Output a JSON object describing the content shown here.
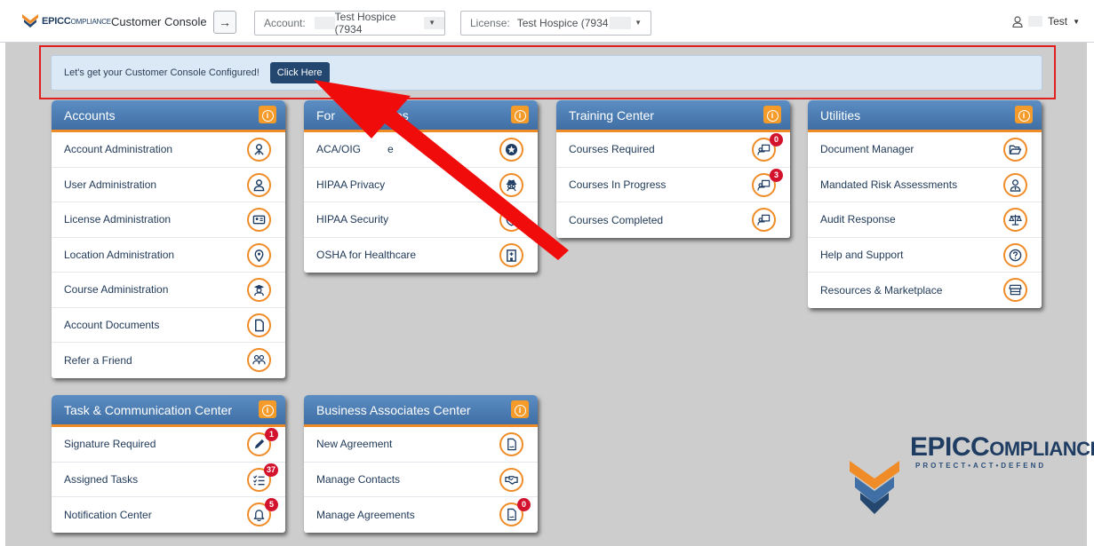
{
  "header": {
    "brand_main": "EPIC",
    "brand_rest": "OMPLIANCE",
    "brand_c": "C",
    "title": "Customer Console",
    "go_icon": "arrow-right-icon",
    "account_label": "Account:",
    "account_value": "Test Hospice (7934",
    "license_label": "License:",
    "license_value": "Test Hospice (7934",
    "user_name": "Test"
  },
  "banner": {
    "message": "Let's get your Customer Console Configured!",
    "cta": "Click Here"
  },
  "accounts": {
    "title": "Accounts",
    "items": [
      {
        "label": "Account Administration",
        "icon": "user-network-icon"
      },
      {
        "label": "User Administration",
        "icon": "user-icon"
      },
      {
        "label": "License Administration",
        "icon": "id-card-icon"
      },
      {
        "label": "Location Administration",
        "icon": "map-pin-icon"
      },
      {
        "label": "Course Administration",
        "icon": "graduate-icon"
      },
      {
        "label": "Account Documents",
        "icon": "document-icon"
      },
      {
        "label": "Refer a Friend",
        "icon": "users-icon"
      }
    ]
  },
  "forms": {
    "title_left": "For",
    "title_right": "es",
    "items": [
      {
        "label_left": "ACA/OIG",
        "label_right": "e",
        "icon": "star-icon"
      },
      {
        "label": "HIPAA Privacy",
        "icon": "spy-icon"
      },
      {
        "label": "HIPAA Security",
        "icon": "shield-icon"
      },
      {
        "label": "OSHA for Healthcare",
        "icon": "hospital-icon"
      }
    ]
  },
  "training": {
    "title": "Training Center",
    "items": [
      {
        "label": "Courses Required",
        "icon": "teacher-board-icon",
        "badge": "0"
      },
      {
        "label": "Courses In Progress",
        "icon": "teacher-board-icon",
        "badge": "3"
      },
      {
        "label": "Courses Completed",
        "icon": "teacher-board-icon"
      }
    ]
  },
  "utilities": {
    "title": "Utilities",
    "items": [
      {
        "label": "Document Manager",
        "icon": "folder-open-icon"
      },
      {
        "label": "Mandated Risk Assessments",
        "icon": "user-tie-icon"
      },
      {
        "label": "Audit Response",
        "icon": "scale-icon"
      },
      {
        "label": "Help and Support",
        "icon": "question-icon"
      },
      {
        "label": "Resources & Marketplace",
        "icon": "store-icon"
      }
    ]
  },
  "tasks": {
    "title": "Task & Communication Center",
    "items": [
      {
        "label": "Signature Required",
        "icon": "pen-icon",
        "badge": "1"
      },
      {
        "label": "Assigned Tasks",
        "icon": "task-list-icon",
        "badge": "37"
      },
      {
        "label": "Notification Center",
        "icon": "bell-icon",
        "badge": "5"
      }
    ]
  },
  "business": {
    "title": "Business Associates Center",
    "items": [
      {
        "label": "New Agreement",
        "icon": "file-signature-icon"
      },
      {
        "label": "Manage Contacts",
        "icon": "handshake-icon"
      },
      {
        "label": "Manage Agreements",
        "icon": "file-signature-icon",
        "badge": "0"
      }
    ]
  },
  "footer_logo": {
    "main": "EPIC",
    "c": "C",
    "rest": "OMPLIANCE",
    "tagline": "PROTECT•ACT•DEFEND"
  },
  "colors": {
    "panel_header": "#4a7bb3",
    "accent_orange": "#f08c28",
    "badge_red": "#d3122e",
    "annotation_red": "#e21f1f"
  }
}
